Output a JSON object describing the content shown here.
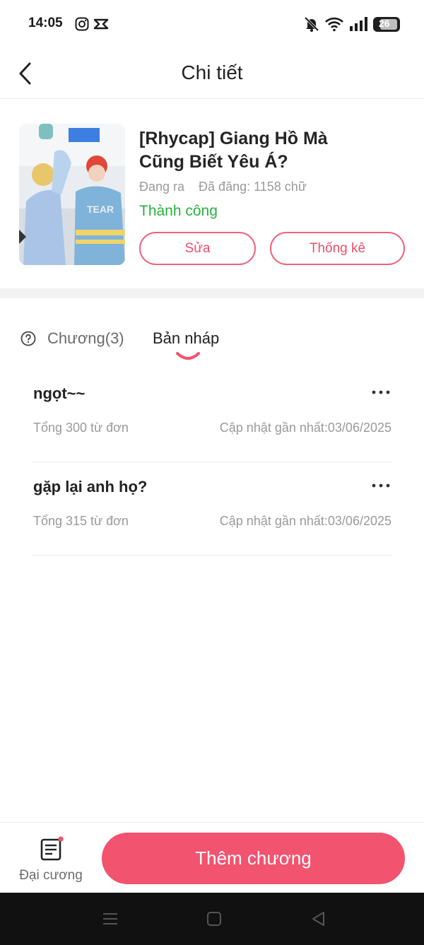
{
  "status_bar": {
    "time": "14:05",
    "battery": "26",
    "icons": [
      "instagram-icon",
      "capcut-icon",
      "bell-off-icon",
      "wifi-icon",
      "signal-icon",
      "battery-icon"
    ]
  },
  "header": {
    "title": "Chi tiết",
    "back_icon": "chevron-left-icon"
  },
  "book": {
    "title": "[Rhycap] Giang Hồ Mà Cũng Biết Yêu Á?",
    "state": "Đang ra",
    "published": "Đã đăng: 1158 chữ",
    "status": "Thành công",
    "edit_label": "Sửa",
    "stats_label": "Thống kê"
  },
  "tabs": {
    "chapters_label": "Chương(3)",
    "drafts_label": "Bản nháp",
    "active": "drafts"
  },
  "drafts": [
    {
      "title": "ngọt~~",
      "words": "Tổng 300 từ đơn",
      "updated": "Cập nhật gần nhất:03/06/2025"
    },
    {
      "title": "gặp lại anh họ?",
      "words": "Tổng 315 từ đơn",
      "updated": "Cập nhật gần nhất:03/06/2025"
    }
  ],
  "bottom_bar": {
    "outline_label": "Đại cương",
    "add_chapter_label": "Thêm chương"
  },
  "colors": {
    "accent": "#f2536f",
    "success": "#27b33c",
    "muted_text": "#9a9a9a"
  }
}
